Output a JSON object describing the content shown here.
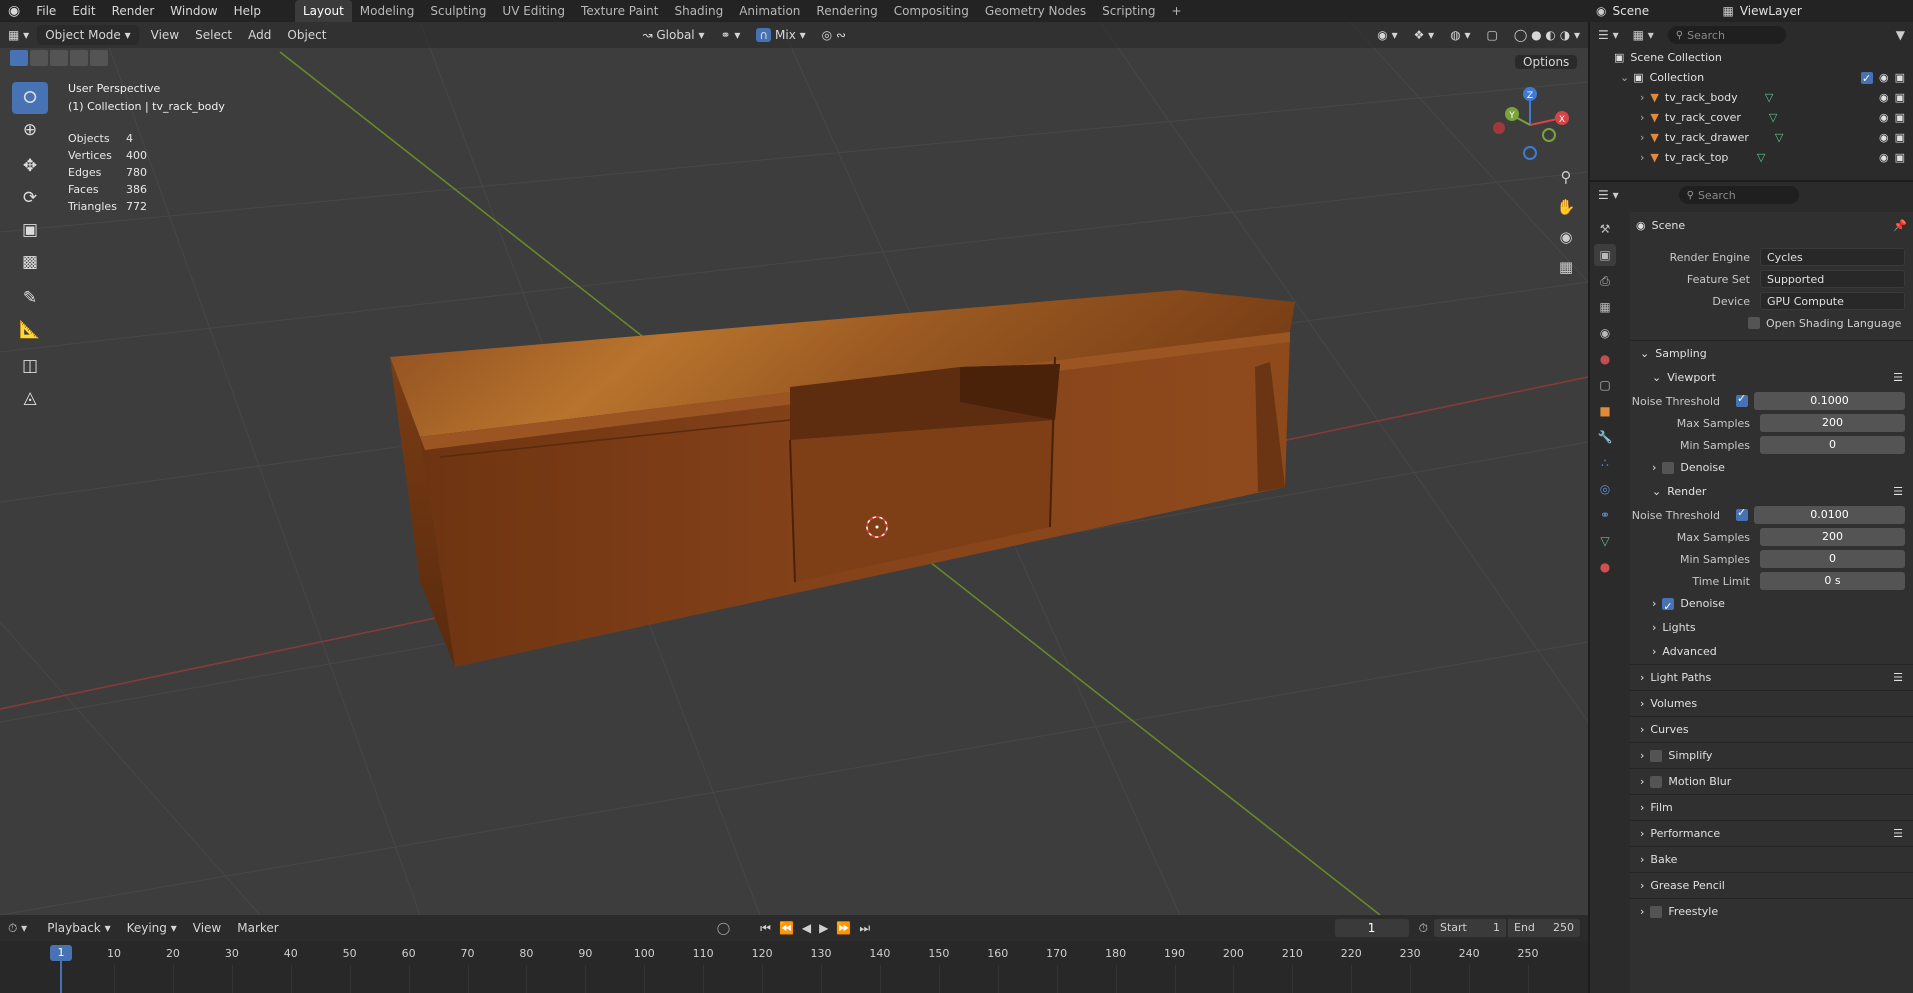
{
  "topbar": {
    "menus": [
      "File",
      "Edit",
      "Render",
      "Window",
      "Help"
    ],
    "workspaces": [
      "Layout",
      "Modeling",
      "Sculpting",
      "UV Editing",
      "Texture Paint",
      "Shading",
      "Animation",
      "Rendering",
      "Compositing",
      "Geometry Nodes",
      "Scripting"
    ],
    "active_workspace": "Layout",
    "add_tab": "+",
    "scene": "Scene",
    "view_layer": "ViewLayer"
  },
  "viewport_header": {
    "mode": "Object Mode",
    "menus": [
      "View",
      "Select",
      "Add",
      "Object"
    ],
    "orientation": "Global",
    "snap": "Mix",
    "options": "Options"
  },
  "overlay": {
    "perspective": "User Perspective",
    "collection": "(1) Collection | tv_rack_body",
    "stats": [
      {
        "label": "Objects",
        "value": "4"
      },
      {
        "label": "Vertices",
        "value": "400"
      },
      {
        "label": "Edges",
        "value": "780"
      },
      {
        "label": "Faces",
        "value": "386"
      },
      {
        "label": "Triangles",
        "value": "772"
      }
    ],
    "gizmo": {
      "x": "X",
      "y": "Y",
      "z": "Z"
    }
  },
  "outliner": {
    "search_placeholder": "Search",
    "root": "Scene Collection",
    "collection": "Collection",
    "objects": [
      "tv_rack_body",
      "tv_rack_cover",
      "tv_rack_drawer",
      "tv_rack_top"
    ]
  },
  "properties": {
    "search_placeholder": "Search",
    "context": "Scene",
    "render_engine_label": "Render Engine",
    "render_engine": "Cycles",
    "feature_set_label": "Feature Set",
    "feature_set": "Supported",
    "device_label": "Device",
    "device": "GPU Compute",
    "osl_label": "Open Shading Language",
    "sampling": "Sampling",
    "viewport": "Viewport",
    "vp_noise_label": "Noise Threshold",
    "vp_noise": "0.1000",
    "vp_max_label": "Max Samples",
    "vp_max": "200",
    "vp_min_label": "Min Samples",
    "vp_min": "0",
    "vp_denoise": "Denoise",
    "render": "Render",
    "r_noise_label": "Noise Threshold",
    "r_noise": "0.0100",
    "r_max_label": "Max Samples",
    "r_max": "200",
    "r_min_label": "Min Samples",
    "r_min": "0",
    "r_time_label": "Time Limit",
    "r_time": "0 s",
    "r_denoise": "Denoise",
    "lights": "Lights",
    "advanced": "Advanced",
    "panels": [
      "Light Paths",
      "Volumes",
      "Curves",
      "Simplify",
      "Motion Blur",
      "Film",
      "Performance",
      "Bake",
      "Grease Pencil",
      "Freestyle"
    ]
  },
  "timeline": {
    "menus": [
      "Playback",
      "Keying",
      "View",
      "Marker"
    ],
    "current_frame": "1",
    "start_label": "Start",
    "start": "1",
    "end_label": "End",
    "end": "250",
    "ticks": [
      "1",
      "10",
      "20",
      "30",
      "40",
      "50",
      "60",
      "70",
      "80",
      "90",
      "100",
      "110",
      "120",
      "130",
      "140",
      "150",
      "160",
      "170",
      "180",
      "190",
      "200",
      "210",
      "220",
      "230",
      "240",
      "250"
    ]
  }
}
